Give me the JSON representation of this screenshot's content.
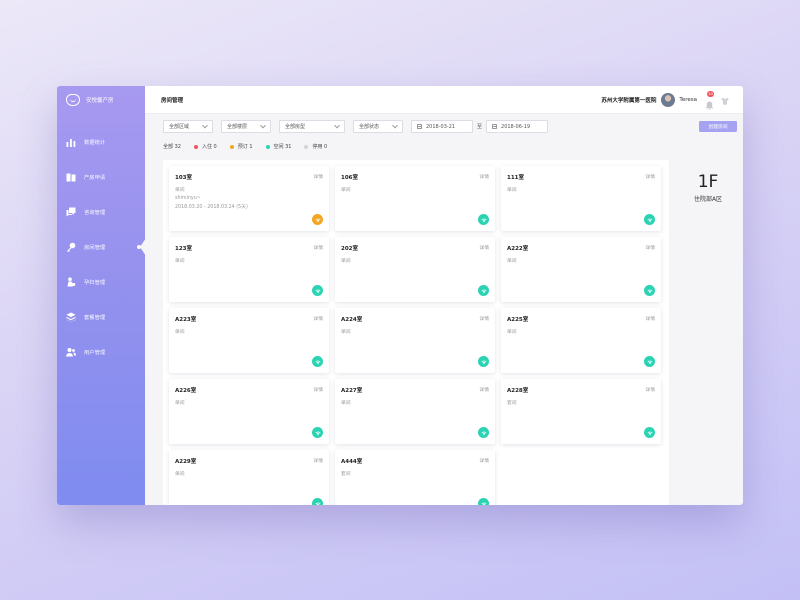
{
  "sidebar": {
    "brand": "安悦馨产房",
    "items": [
      {
        "label": "数据统计",
        "icon": "bar-chart-icon"
      },
      {
        "label": "产房申请",
        "icon": "bed-icon"
      },
      {
        "label": "咨询管理",
        "icon": "chat-icon"
      },
      {
        "label": "房间管理",
        "icon": "key-icon",
        "active": true
      },
      {
        "label": "孕妇管理",
        "icon": "mother-icon"
      },
      {
        "label": "套餐管理",
        "icon": "layers-icon"
      },
      {
        "label": "用户管理",
        "icon": "users-icon"
      }
    ]
  },
  "header": {
    "title": "房间管理",
    "hospital": "苏州大学附属第一医院",
    "username": "Teresa",
    "notification_count": "10"
  },
  "filters": {
    "area": "全部区域",
    "floor": "全部楼层",
    "room_type": "全部房型",
    "status": "全部状态",
    "date_from": "2018-03-21",
    "to": "至",
    "date_to": "2018-06-19",
    "create_button": "创建房间"
  },
  "legend": {
    "all": "全部 32",
    "items": [
      {
        "label": "入住 0",
        "color": "#ee5560"
      },
      {
        "label": "预订 1",
        "color": "#f4a623"
      },
      {
        "label": "空闲 31",
        "color": "#2bd3b3"
      },
      {
        "label": "停用 0",
        "color": "#d3d3d8"
      }
    ]
  },
  "detail_label": "详情",
  "rooms": [
    {
      "name": "103室",
      "type": "单间",
      "guest": "shiminyu~",
      "dates": "2018.03.20 - 2018.03.24 (5天)",
      "status": "booked"
    },
    {
      "name": "106室",
      "type": "单间",
      "status": "free"
    },
    {
      "name": "111室",
      "type": "单间",
      "status": "free"
    },
    {
      "name": "123室",
      "type": "单间",
      "status": "free"
    },
    {
      "name": "202室",
      "type": "单间",
      "status": "free"
    },
    {
      "name": "A222室",
      "type": "单间",
      "status": "free"
    },
    {
      "name": "A223室",
      "type": "单间",
      "status": "free"
    },
    {
      "name": "A224室",
      "type": "单间",
      "status": "free"
    },
    {
      "name": "A225室",
      "type": "单间",
      "status": "free"
    },
    {
      "name": "A226室",
      "type": "单间",
      "status": "free"
    },
    {
      "name": "A227室",
      "type": "单间",
      "status": "free"
    },
    {
      "name": "A228室",
      "type": "套间",
      "status": "free"
    },
    {
      "name": "A229室",
      "type": "单间",
      "status": "free"
    },
    {
      "name": "A444室",
      "type": "套间",
      "status": "free"
    }
  ],
  "status_colors": {
    "booked": "#f4a623",
    "free": "#2bd3b3"
  },
  "floor": {
    "number": "1F",
    "area": "住院部A区"
  }
}
